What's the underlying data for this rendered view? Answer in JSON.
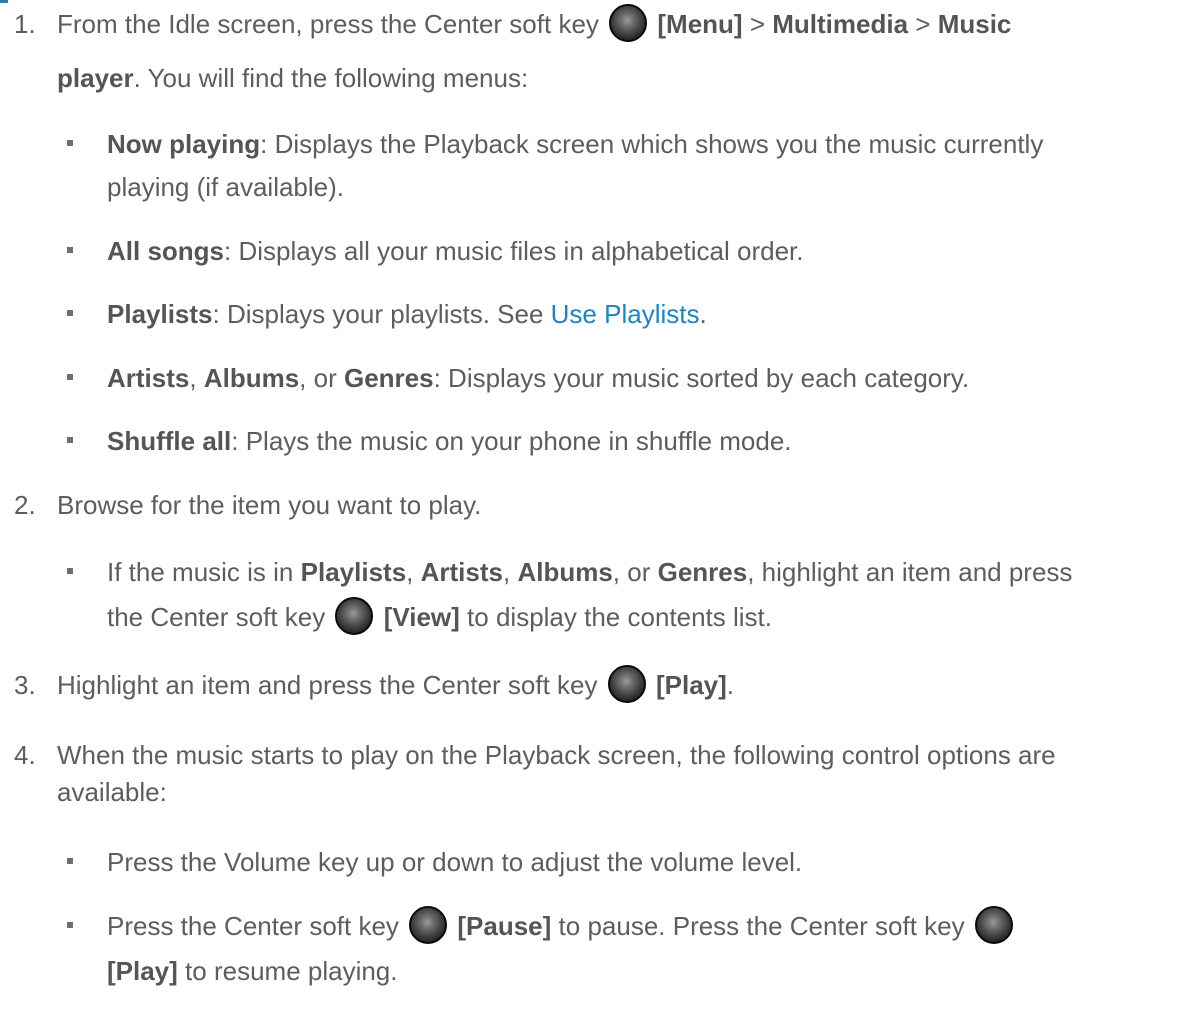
{
  "s1": {
    "num": "1.",
    "a": "From the Idle screen, press the Center soft key",
    "b1": "[Menu]",
    "c": ">",
    "b2": "Multimedia",
    "d": ">",
    "b3": "Music",
    "b4": "player",
    "e": ". You will find the following menus:"
  },
  "items": [
    {
      "bold": "Now playing",
      "t1": ": Displays the Playback screen which shows you the music currently",
      "t2": "playing (if available)."
    },
    {
      "bold": "All songs",
      "t1": ": Displays all your music files in alphabetical order."
    },
    {
      "bold": "Playlists",
      "t1": ": Displays your playlists. See",
      "link": "Use Playlists",
      "t2": "."
    },
    {
      "b1": "Artists",
      "c1": ",",
      "b2": "Albums",
      "c2": ", or",
      "b3": "Genres",
      "t1": ": Displays your music sorted by each category."
    },
    {
      "bold": "Shuffle all",
      "t1": ": Plays the music on your phone in shuffle mode."
    }
  ],
  "s2": {
    "num": "2.",
    "text": "Browse for the item you want to play.",
    "b_a": "If the music is in",
    "b_b1": "Playlists",
    "b_c1": ",",
    "b_b2": "Artists",
    "b_c2": ",",
    "b_b3": "Albums",
    "b_c3": ", or",
    "b_b4": "Genres",
    "b_d": ", highlight an item and press",
    "b_e": "the Center soft key",
    "b_f": "[View]",
    "b_g": "to display the contents list."
  },
  "s3": {
    "num": "3.",
    "a": "Highlight an item and press the Center soft key",
    "b": "[Play]",
    "c": "."
  },
  "s4": {
    "num": "4.",
    "t1": "When the music starts to play on the Playback screen, the following control options are",
    "t2": "available:",
    "bul1": "Press the Volume key up or down to adjust the volume level.",
    "bul2a": "Press the Center soft key",
    "bul2b": "[Pause]",
    "bul2c": "to pause. Press the Center soft key",
    "bul2d": "[Play]",
    "bul2e": "to resume playing."
  },
  "icon": "center-soft-key-icon",
  "colors": {
    "link": "#1a85c2",
    "text": "#5d5d5d"
  }
}
